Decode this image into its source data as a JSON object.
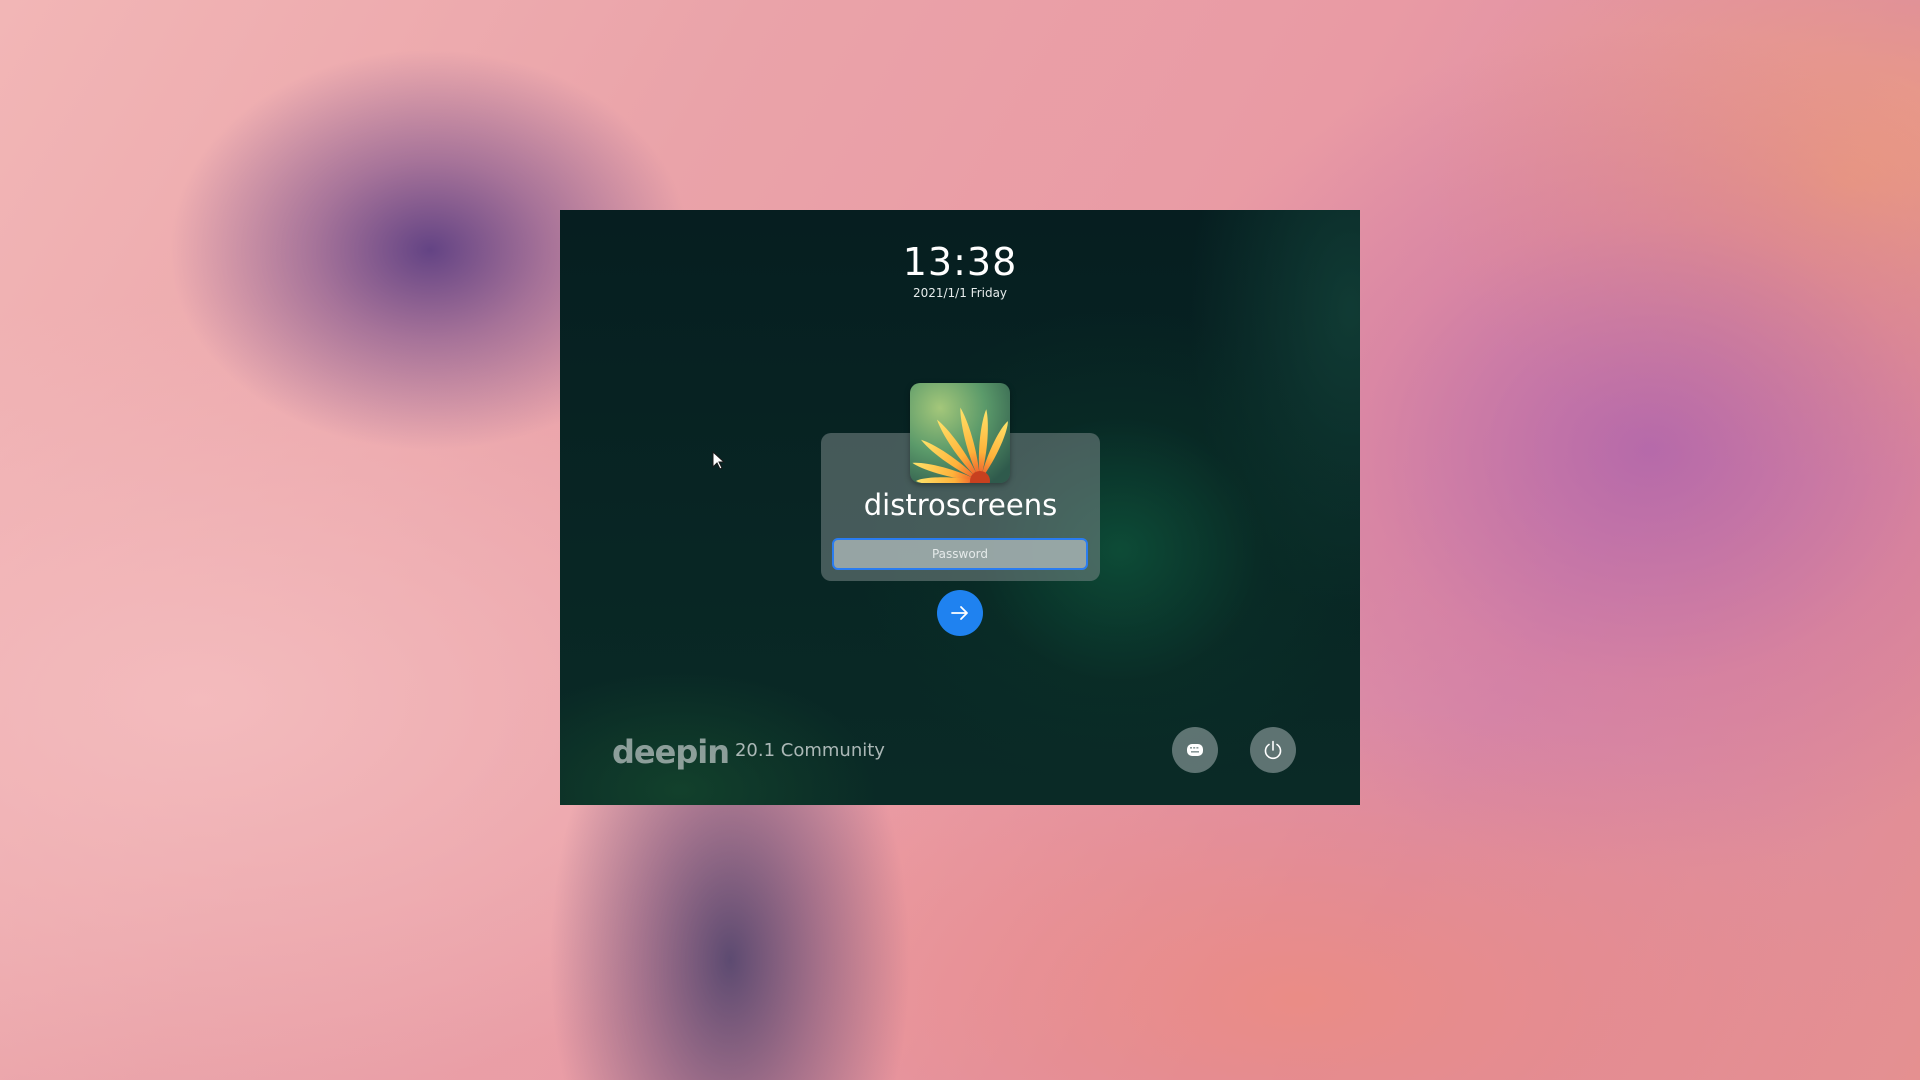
{
  "lock_screen": {
    "time": "13:38",
    "date": "2021/1/1 Friday",
    "username": "distroscreens",
    "password_placeholder": "Password",
    "os_logo": "deepin",
    "os_version": "20.1 Community"
  },
  "icons": {
    "submit": "arrow-right-icon",
    "keyboard_layout": "keyboard-icon",
    "power": "power-icon",
    "avatar": "flower-avatar",
    "cursor": "mouse-pointer-icon"
  },
  "colors": {
    "accent": "#1f82f0",
    "input_border": "#2a7cf0",
    "panel_background": "#061e20"
  }
}
